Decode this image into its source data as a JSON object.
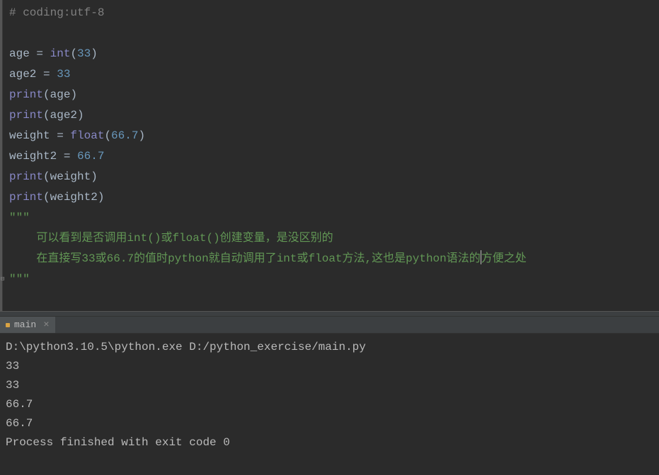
{
  "code": {
    "l1_comment": "# coding:utf-8",
    "l3_ident1": "age",
    "l3_eq": " = ",
    "l3_func": "int",
    "l3_open": "(",
    "l3_num": "33",
    "l3_close": ")",
    "l4_ident": "age2",
    "l4_eq": " = ",
    "l4_num": "33",
    "l5_func": "print",
    "l5_open": "(",
    "l5_arg": "age",
    "l5_close": ")",
    "l6_func": "print",
    "l6_open": "(",
    "l6_arg": "age2",
    "l6_close": ")",
    "l7_ident": "weight",
    "l7_eq": " = ",
    "l7_func": "float",
    "l7_open": "(",
    "l7_num": "66.7",
    "l7_close": ")",
    "l8_ident": "weight2",
    "l8_eq": " = ",
    "l8_num": "66.7",
    "l9_func": "print",
    "l9_open": "(",
    "l9_arg": "weight",
    "l9_close": ")",
    "l10_func": "print",
    "l10_open": "(",
    "l10_arg": "weight2",
    "l10_close": ")",
    "l11_docq": "\"\"\"",
    "l12_indent": "    ",
    "l12a": "可以看到是否调用",
    "l12b": "int()",
    "l12c": "或",
    "l12d": "float()",
    "l12e": "创建变量，是没区别的",
    "l13_indent": "    ",
    "l13a": "在直接写",
    "l13b": "33",
    "l13c": "或",
    "l13d": "66.7",
    "l13e": "的值时",
    "l13f": "python",
    "l13g": "就自动调用了",
    "l13h": "int",
    "l13i": "或",
    "l13j": "float",
    "l13k": "方法,这也是",
    "l13l": "python",
    "l13m": "语法的",
    "l13n": "方便之处",
    "l14_docq": "\"\"\""
  },
  "tab": {
    "name": "main",
    "close": "×"
  },
  "console": {
    "l1": "D:\\python3.10.5\\python.exe D:/python_exercise/main.py",
    "l2": "33",
    "l3": "33",
    "l4": "66.7",
    "l5": "66.7",
    "l6": "",
    "l7": "Process finished with exit code 0"
  }
}
